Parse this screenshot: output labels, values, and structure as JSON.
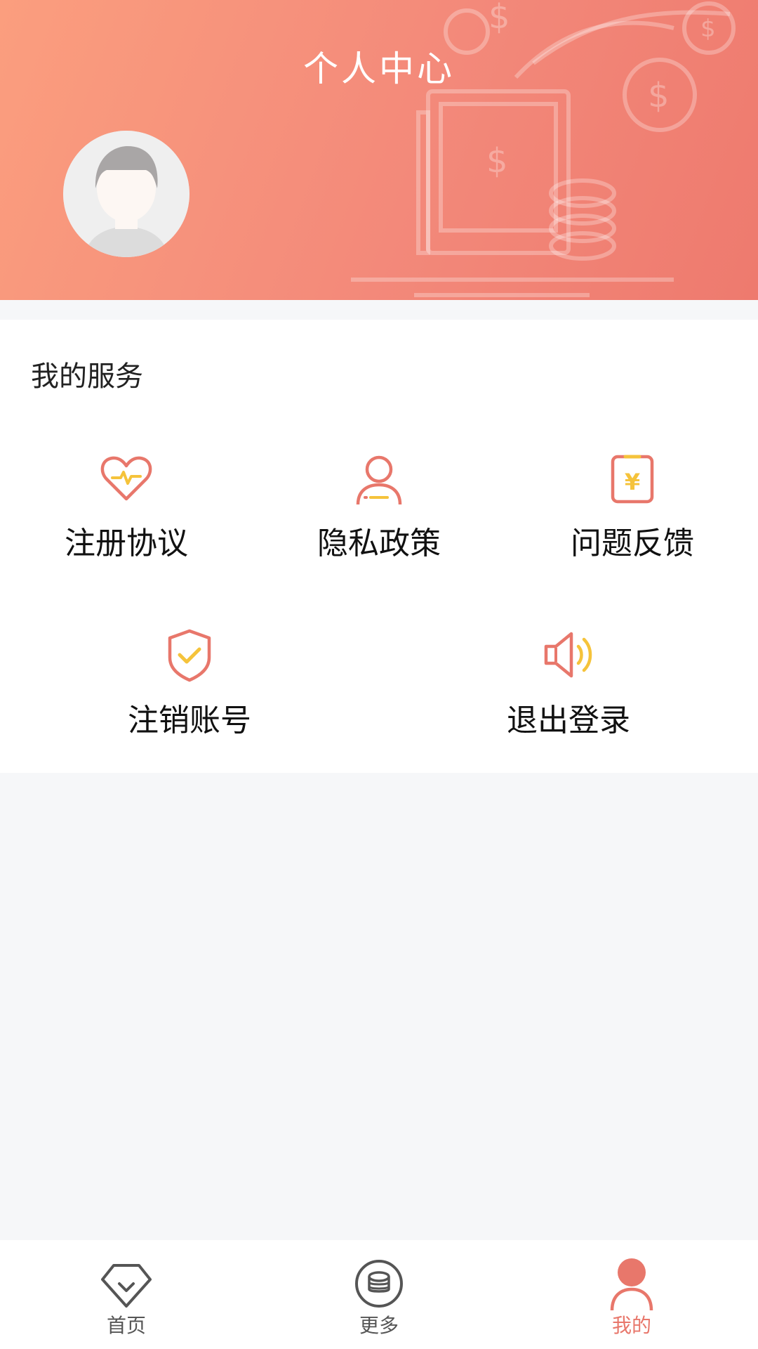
{
  "header": {
    "title": "个人中心"
  },
  "services": {
    "title": "我的服务",
    "items": [
      {
        "label": "注册协议",
        "icon": "heart-pulse-icon"
      },
      {
        "label": "隐私政策",
        "icon": "person-icon"
      },
      {
        "label": "问题反馈",
        "icon": "clipboard-yen-icon"
      },
      {
        "label": "注销账号",
        "icon": "shield-check-icon"
      },
      {
        "label": "退出登录",
        "icon": "speaker-icon"
      }
    ]
  },
  "tabbar": {
    "items": [
      {
        "label": "首页",
        "icon": "diamond-icon",
        "active": false
      },
      {
        "label": "更多",
        "icon": "coins-icon",
        "active": false
      },
      {
        "label": "我的",
        "icon": "user-icon",
        "active": true
      }
    ]
  },
  "colors": {
    "accent": "#e8776b",
    "highlight": "#f5c33b",
    "background": "#f6f7f9"
  }
}
